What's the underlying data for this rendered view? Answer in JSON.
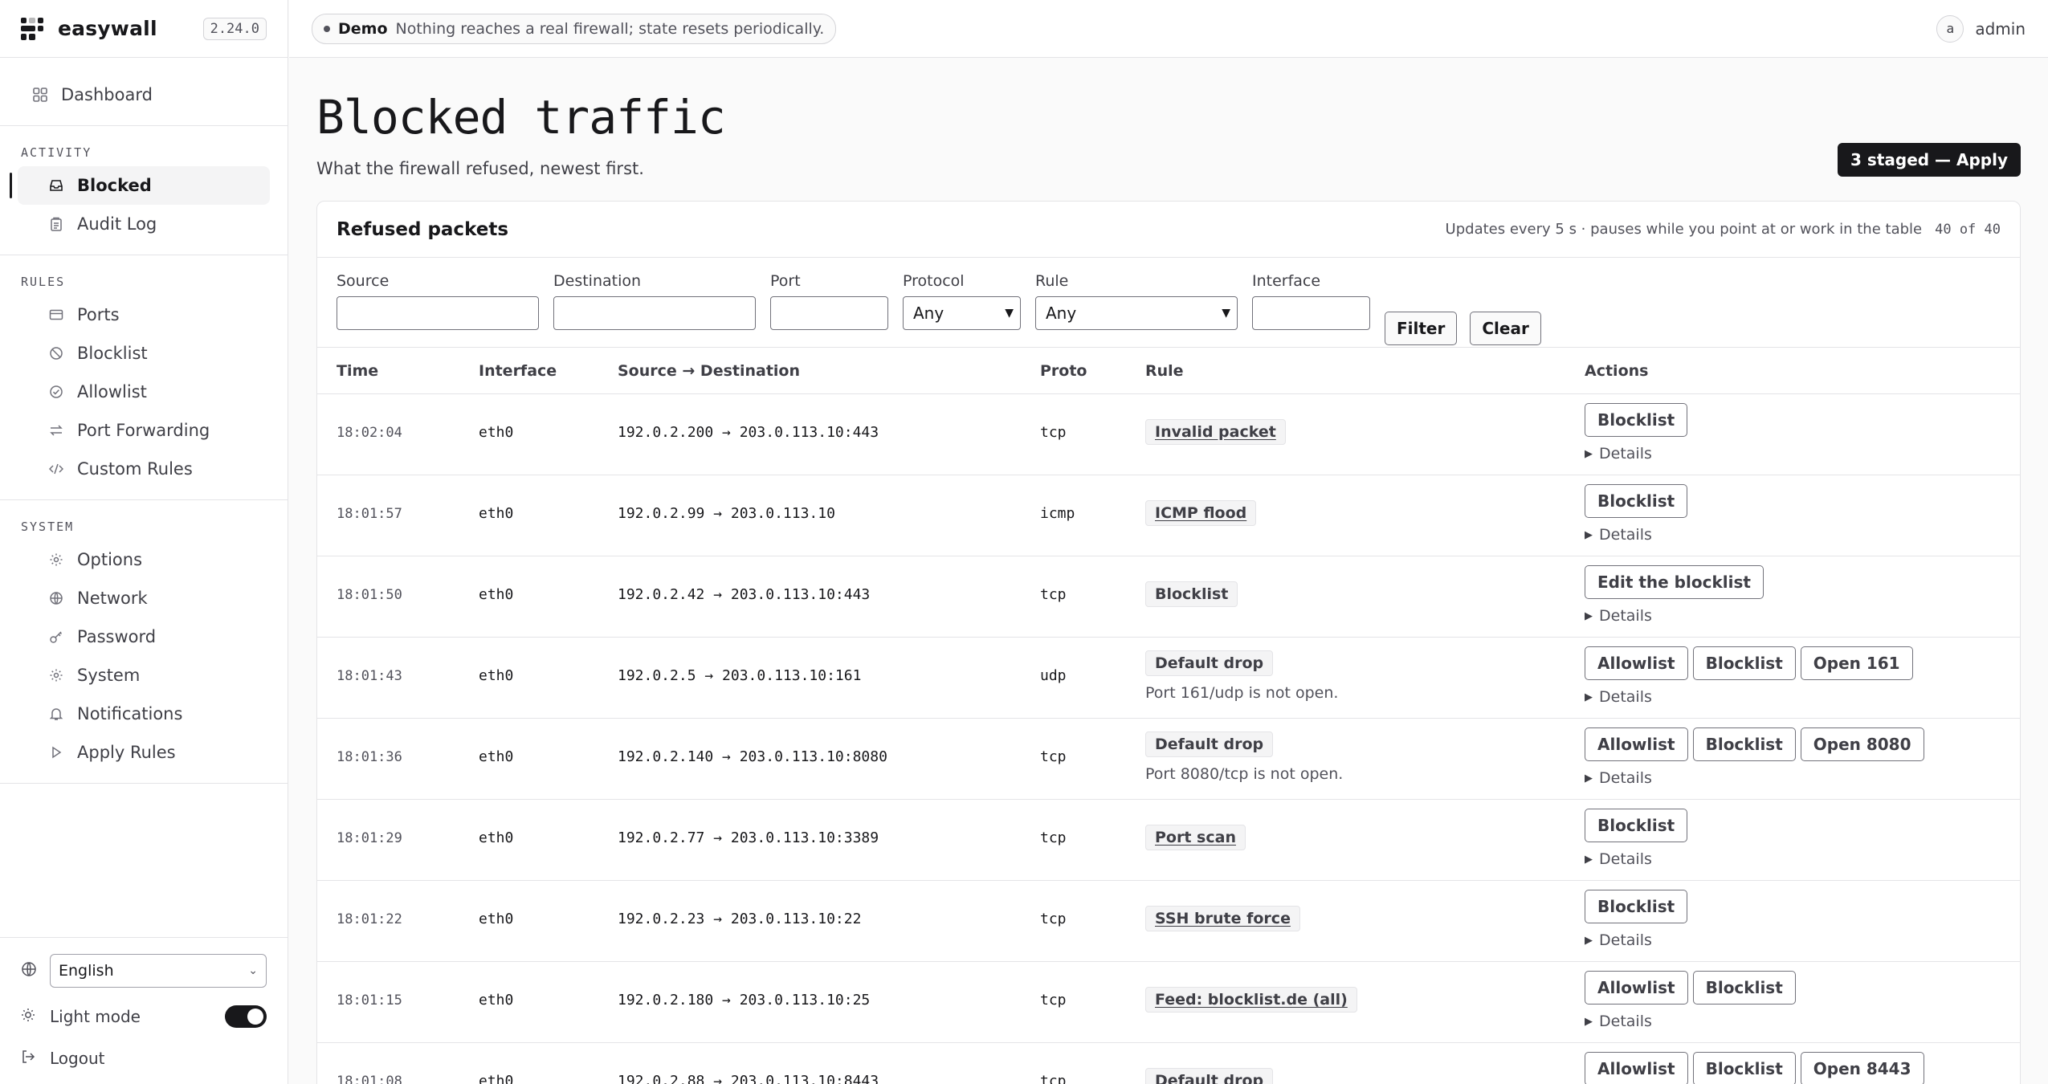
{
  "app": {
    "name": "easywall",
    "version": "2.24.0"
  },
  "sidebar": {
    "dashboard": "Dashboard",
    "sections": [
      {
        "heading": "Activity",
        "items": [
          {
            "label": "Blocked",
            "icon": "inbox-icon",
            "active": true
          },
          {
            "label": "Audit Log",
            "icon": "clipboard-icon"
          }
        ]
      },
      {
        "heading": "Rules",
        "items": [
          {
            "label": "Ports",
            "icon": "port-icon"
          },
          {
            "label": "Blocklist",
            "icon": "ban-icon"
          },
          {
            "label": "Allowlist",
            "icon": "check-circle-icon"
          },
          {
            "label": "Port Forwarding",
            "icon": "arrows-icon"
          },
          {
            "label": "Custom Rules",
            "icon": "code-icon"
          }
        ]
      },
      {
        "heading": "System",
        "items": [
          {
            "label": "Options",
            "icon": "gear-icon"
          },
          {
            "label": "Network",
            "icon": "globe-icon"
          },
          {
            "label": "Password",
            "icon": "key-icon"
          },
          {
            "label": "System",
            "icon": "gear-icon"
          },
          {
            "label": "Notifications",
            "icon": "bell-icon"
          },
          {
            "label": "Apply Rules",
            "icon": "play-icon"
          }
        ]
      }
    ],
    "language": "English",
    "mode_label": "Light mode",
    "logout": "Logout"
  },
  "topbar": {
    "demo_label": "Demo",
    "demo_text": "Nothing reaches a real firewall; state resets periodically.",
    "avatar": "a",
    "user": "admin"
  },
  "page": {
    "title": "Blocked traffic",
    "subtitle": "What the firewall refused, newest first.",
    "apply_button": "3 staged — Apply"
  },
  "card": {
    "title": "Refused packets",
    "meta": "Updates every 5 s · pauses while you point at or work in the table",
    "count": "40 of 40"
  },
  "filters": {
    "source": "Source",
    "destination": "Destination",
    "port": "Port",
    "protocol": "Protocol",
    "protocol_value": "Any",
    "rule": "Rule",
    "rule_value": "Any",
    "interface": "Interface",
    "filter_button": "Filter",
    "clear_button": "Clear"
  },
  "table": {
    "headers": {
      "time": "Time",
      "interface": "Interface",
      "sd": "Source → Destination",
      "proto": "Proto",
      "rule": "Rule",
      "actions": "Actions"
    },
    "details_label": "Details",
    "rows": [
      {
        "time": "18:02:04",
        "iface": "eth0",
        "sd": "192.0.2.200 → 203.0.113.10:443",
        "proto": "tcp",
        "rule": "Invalid packet",
        "link": true,
        "note": "",
        "actions": [
          "Blocklist"
        ]
      },
      {
        "time": "18:01:57",
        "iface": "eth0",
        "sd": "192.0.2.99 → 203.0.113.10",
        "proto": "icmp",
        "rule": "ICMP flood",
        "link": true,
        "note": "",
        "actions": [
          "Blocklist"
        ]
      },
      {
        "time": "18:01:50",
        "iface": "eth0",
        "sd": "192.0.2.42 → 203.0.113.10:443",
        "proto": "tcp",
        "rule": "Blocklist",
        "link": false,
        "note": "",
        "actions": [
          "Edit the blocklist"
        ]
      },
      {
        "time": "18:01:43",
        "iface": "eth0",
        "sd": "192.0.2.5 → 203.0.113.10:161",
        "proto": "udp",
        "rule": "Default drop",
        "link": false,
        "note": "Port 161/udp is not open.",
        "actions": [
          "Allowlist",
          "Blocklist",
          "Open 161"
        ]
      },
      {
        "time": "18:01:36",
        "iface": "eth0",
        "sd": "192.0.2.140 → 203.0.113.10:8080",
        "proto": "tcp",
        "rule": "Default drop",
        "link": false,
        "note": "Port 8080/tcp is not open.",
        "actions": [
          "Allowlist",
          "Blocklist",
          "Open 8080"
        ]
      },
      {
        "time": "18:01:29",
        "iface": "eth0",
        "sd": "192.0.2.77 → 203.0.113.10:3389",
        "proto": "tcp",
        "rule": "Port scan",
        "link": true,
        "note": "",
        "actions": [
          "Blocklist"
        ]
      },
      {
        "time": "18:01:22",
        "iface": "eth0",
        "sd": "192.0.2.23 → 203.0.113.10:22",
        "proto": "tcp",
        "rule": "SSH brute force",
        "link": true,
        "note": "",
        "actions": [
          "Blocklist"
        ]
      },
      {
        "time": "18:01:15",
        "iface": "eth0",
        "sd": "192.0.2.180 → 203.0.113.10:25",
        "proto": "tcp",
        "rule": "Feed: blocklist.de (all)",
        "link": true,
        "note": "",
        "actions": [
          "Allowlist",
          "Blocklist"
        ]
      },
      {
        "time": "18:01:08",
        "iface": "eth0",
        "sd": "192.0.2.88 → 203.0.113.10:8443",
        "proto": "tcp",
        "rule": "Default drop",
        "link": false,
        "note": "",
        "actions": [
          "Allowlist",
          "Blocklist",
          "Open 8443"
        ]
      }
    ]
  }
}
